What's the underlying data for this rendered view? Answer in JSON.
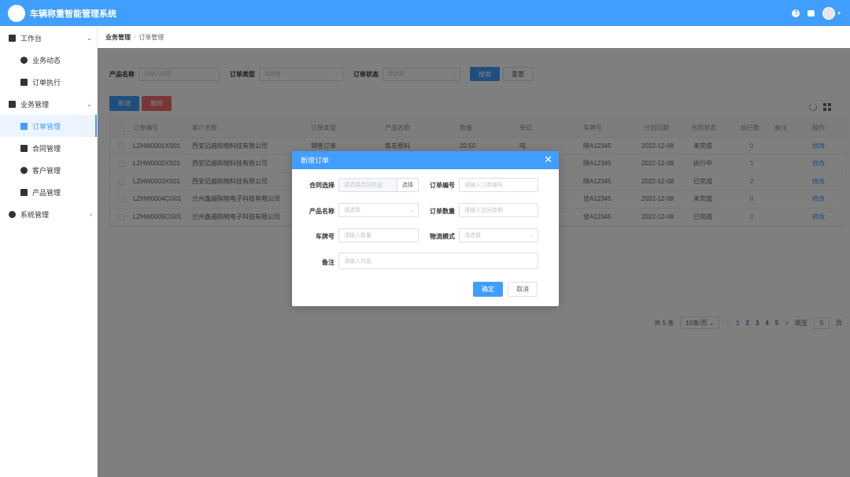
{
  "app": {
    "title": "车辆称重智能管理系统"
  },
  "header": {
    "help_icon": "question-circle-icon",
    "message_icon": "message-icon",
    "avatar_icon": "user-avatar"
  },
  "sidebar": {
    "items": [
      {
        "label": "工作台",
        "icon": "cube-icon",
        "arrow": "⌄"
      },
      {
        "label": "业务动态",
        "icon": "chart-icon"
      },
      {
        "label": "订单执行",
        "icon": "check-square-icon"
      },
      {
        "label": "业务管理",
        "icon": "briefcase-icon",
        "arrow": "⌄"
      },
      {
        "label": "订单管理",
        "icon": "document-icon",
        "active": true
      },
      {
        "label": "合同管理",
        "icon": "contract-icon"
      },
      {
        "label": "客户管理",
        "icon": "customer-icon"
      },
      {
        "label": "产品管理",
        "icon": "product-icon"
      },
      {
        "label": "系统管理",
        "icon": "gear-icon",
        "arrow": "›"
      }
    ]
  },
  "breadcrumb": {
    "root": "业务管理",
    "sep": "/",
    "current": "订单管理"
  },
  "filters": {
    "product_name_label": "产品名称",
    "product_name_placeholder": "请输入内容",
    "order_type_label": "订单类型",
    "order_type_placeholder": "请选择",
    "order_status_label": "订单状态",
    "order_status_placeholder": "请选择",
    "search_label": "搜索",
    "reset_label": "重置"
  },
  "actions": {
    "add_label": "新增",
    "delete_label": "删除"
  },
  "table": {
    "headers": [
      "订单编号",
      "客户名称",
      "订单类型",
      "产品名称",
      "数量",
      "单位",
      "车牌号",
      "计划日期",
      "合同状态",
      "执行数",
      "备注",
      "操作"
    ],
    "rows": [
      [
        "LZHW0001XS01",
        "西安迈越购物科技有限公司",
        "销售订单",
        "焦炭原料",
        "20.50",
        "吨",
        "陕A12345",
        "2022-12-08",
        "未完成",
        "0",
        "",
        "修改"
      ],
      [
        "LZHW0002XS01",
        "西安迈越购物科技有限公司",
        "",
        "",
        "",
        "",
        "陕A12345",
        "2022-12-08",
        "执行中",
        "1",
        "",
        "修改"
      ],
      [
        "LZHW0003XS01",
        "西安迈越购物科技有限公司",
        "",
        "",
        "",
        "",
        "陕A12345",
        "2022-12-08",
        "已完成",
        "2",
        "",
        "修改"
      ],
      [
        "LZHW0004CG01",
        "兰州鑫越购物电子科技有限公司",
        "",
        "",
        "",
        "",
        "甘A12345",
        "2022-12-08",
        "未完成",
        "0",
        "",
        "修改"
      ],
      [
        "LZHW0005CG01",
        "兰州鑫越购物电子科技有限公司",
        "",
        "",
        "",
        "",
        "甘A12345",
        "2022-12-08",
        "已完成",
        "0",
        "",
        "修改"
      ]
    ]
  },
  "pagination": {
    "total": "共 5 条",
    "page_size": "10条/页",
    "prev": "<",
    "pages": [
      "1",
      "2",
      "3",
      "4",
      "5"
    ],
    "next": ">",
    "jump_label": "跳至",
    "jump_value": "5",
    "jump_suffix": "页"
  },
  "dialog": {
    "title": "新增订单",
    "contract_label": "合同选择",
    "contract_placeholder": "请选择合同信息",
    "contract_append": "选择",
    "order_no_label": "订单编号",
    "order_no_placeholder": "请输入订单编号",
    "product_label": "产品名称",
    "product_placeholder": "请选择",
    "quantity_label": "订单数量",
    "quantity_placeholder": "请输入合同金额",
    "plate_label": "车牌号",
    "plate_placeholder": "请输入数量",
    "logistics_label": "物流模式",
    "logistics_placeholder": "请选择",
    "remark_label": "备注",
    "remark_placeholder": "请输入内容",
    "confirm_label": "确定",
    "cancel_label": "取消"
  },
  "colors": {
    "primary": "#409eff",
    "danger": "#f56c6c",
    "overlay": "rgba(0,0,0,0.5)"
  }
}
